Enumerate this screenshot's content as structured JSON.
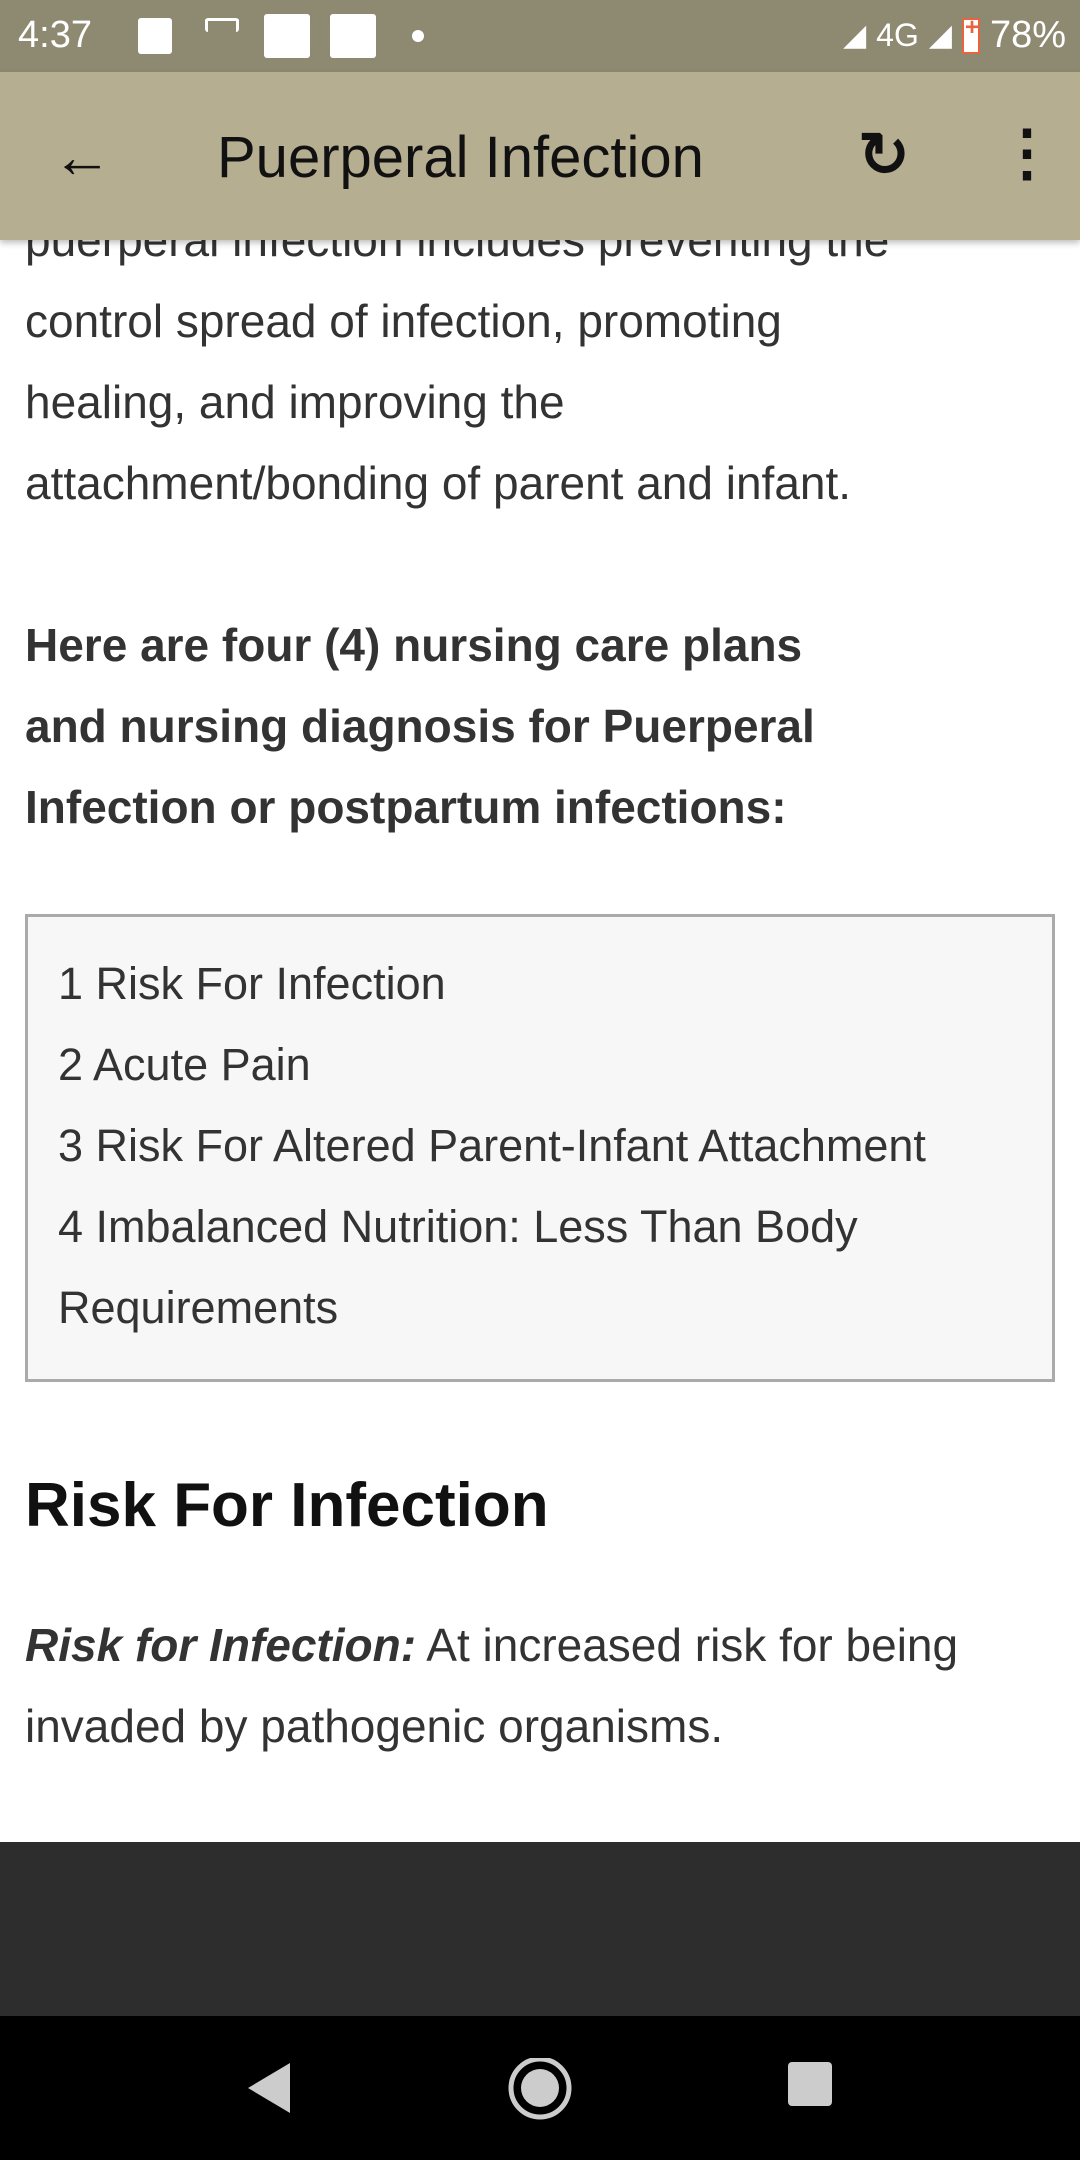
{
  "status": {
    "time": "4:37",
    "network": "4G",
    "battery": "78%"
  },
  "toolbar": {
    "title": "Puerperal Infection",
    "back_icon": "arrow-left-icon",
    "refresh_icon": "refresh-icon",
    "more_icon": "more-vert-icon"
  },
  "content": {
    "partial_line": "puerperal infection includes preventing the",
    "intro": [
      "control spread of infection, promoting",
      "healing, and improving the",
      "attachment/bonding of parent and infant."
    ],
    "lead": [
      "Here are four (4) nursing care plans",
      "and nursing diagnosis for Puerperal",
      "Infection or postpartum infections:"
    ],
    "toc": [
      "1 Risk For Infection",
      "2 Acute Pain",
      "3 Risk For Altered Parent-Infant Attachment",
      "4 Imbalanced Nutrition: Less Than Body",
      "Requirements"
    ],
    "heading": "Risk For Infection",
    "def_label": "Risk for Infection:",
    "def_text": " At increased risk for being",
    "def_text2": "invaded by pathogenic organisms."
  }
}
